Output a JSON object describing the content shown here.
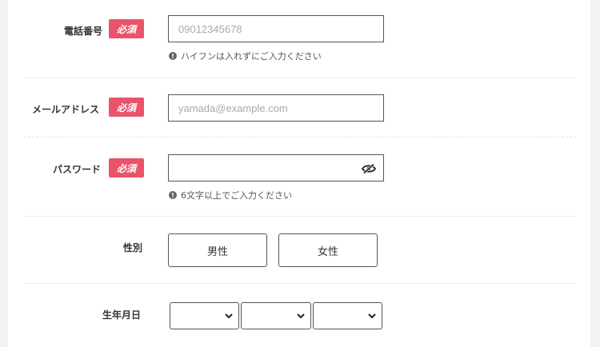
{
  "form": {
    "required_label": "必須",
    "phone": {
      "label": "電話番号",
      "placeholder": "09012345678",
      "hint": "ハイフンは入れずにご入力ください"
    },
    "email": {
      "label": "メールアドレス",
      "placeholder": "yamada@example.com"
    },
    "password": {
      "label": "パスワード",
      "value": "",
      "hint": "6文字以上でご入力ください"
    },
    "gender": {
      "label": "性別",
      "options": [
        "男性",
        "女性"
      ]
    },
    "birthdate": {
      "label": "生年月日",
      "year": "",
      "month": "",
      "day": ""
    }
  },
  "icons": {
    "info": "info-icon",
    "eye": "eye-slash-icon",
    "chevron": "chevron-down-icon"
  },
  "colors": {
    "required_badge": "#e9546b",
    "background": "#f2f2f2",
    "card": "#ffffff"
  }
}
